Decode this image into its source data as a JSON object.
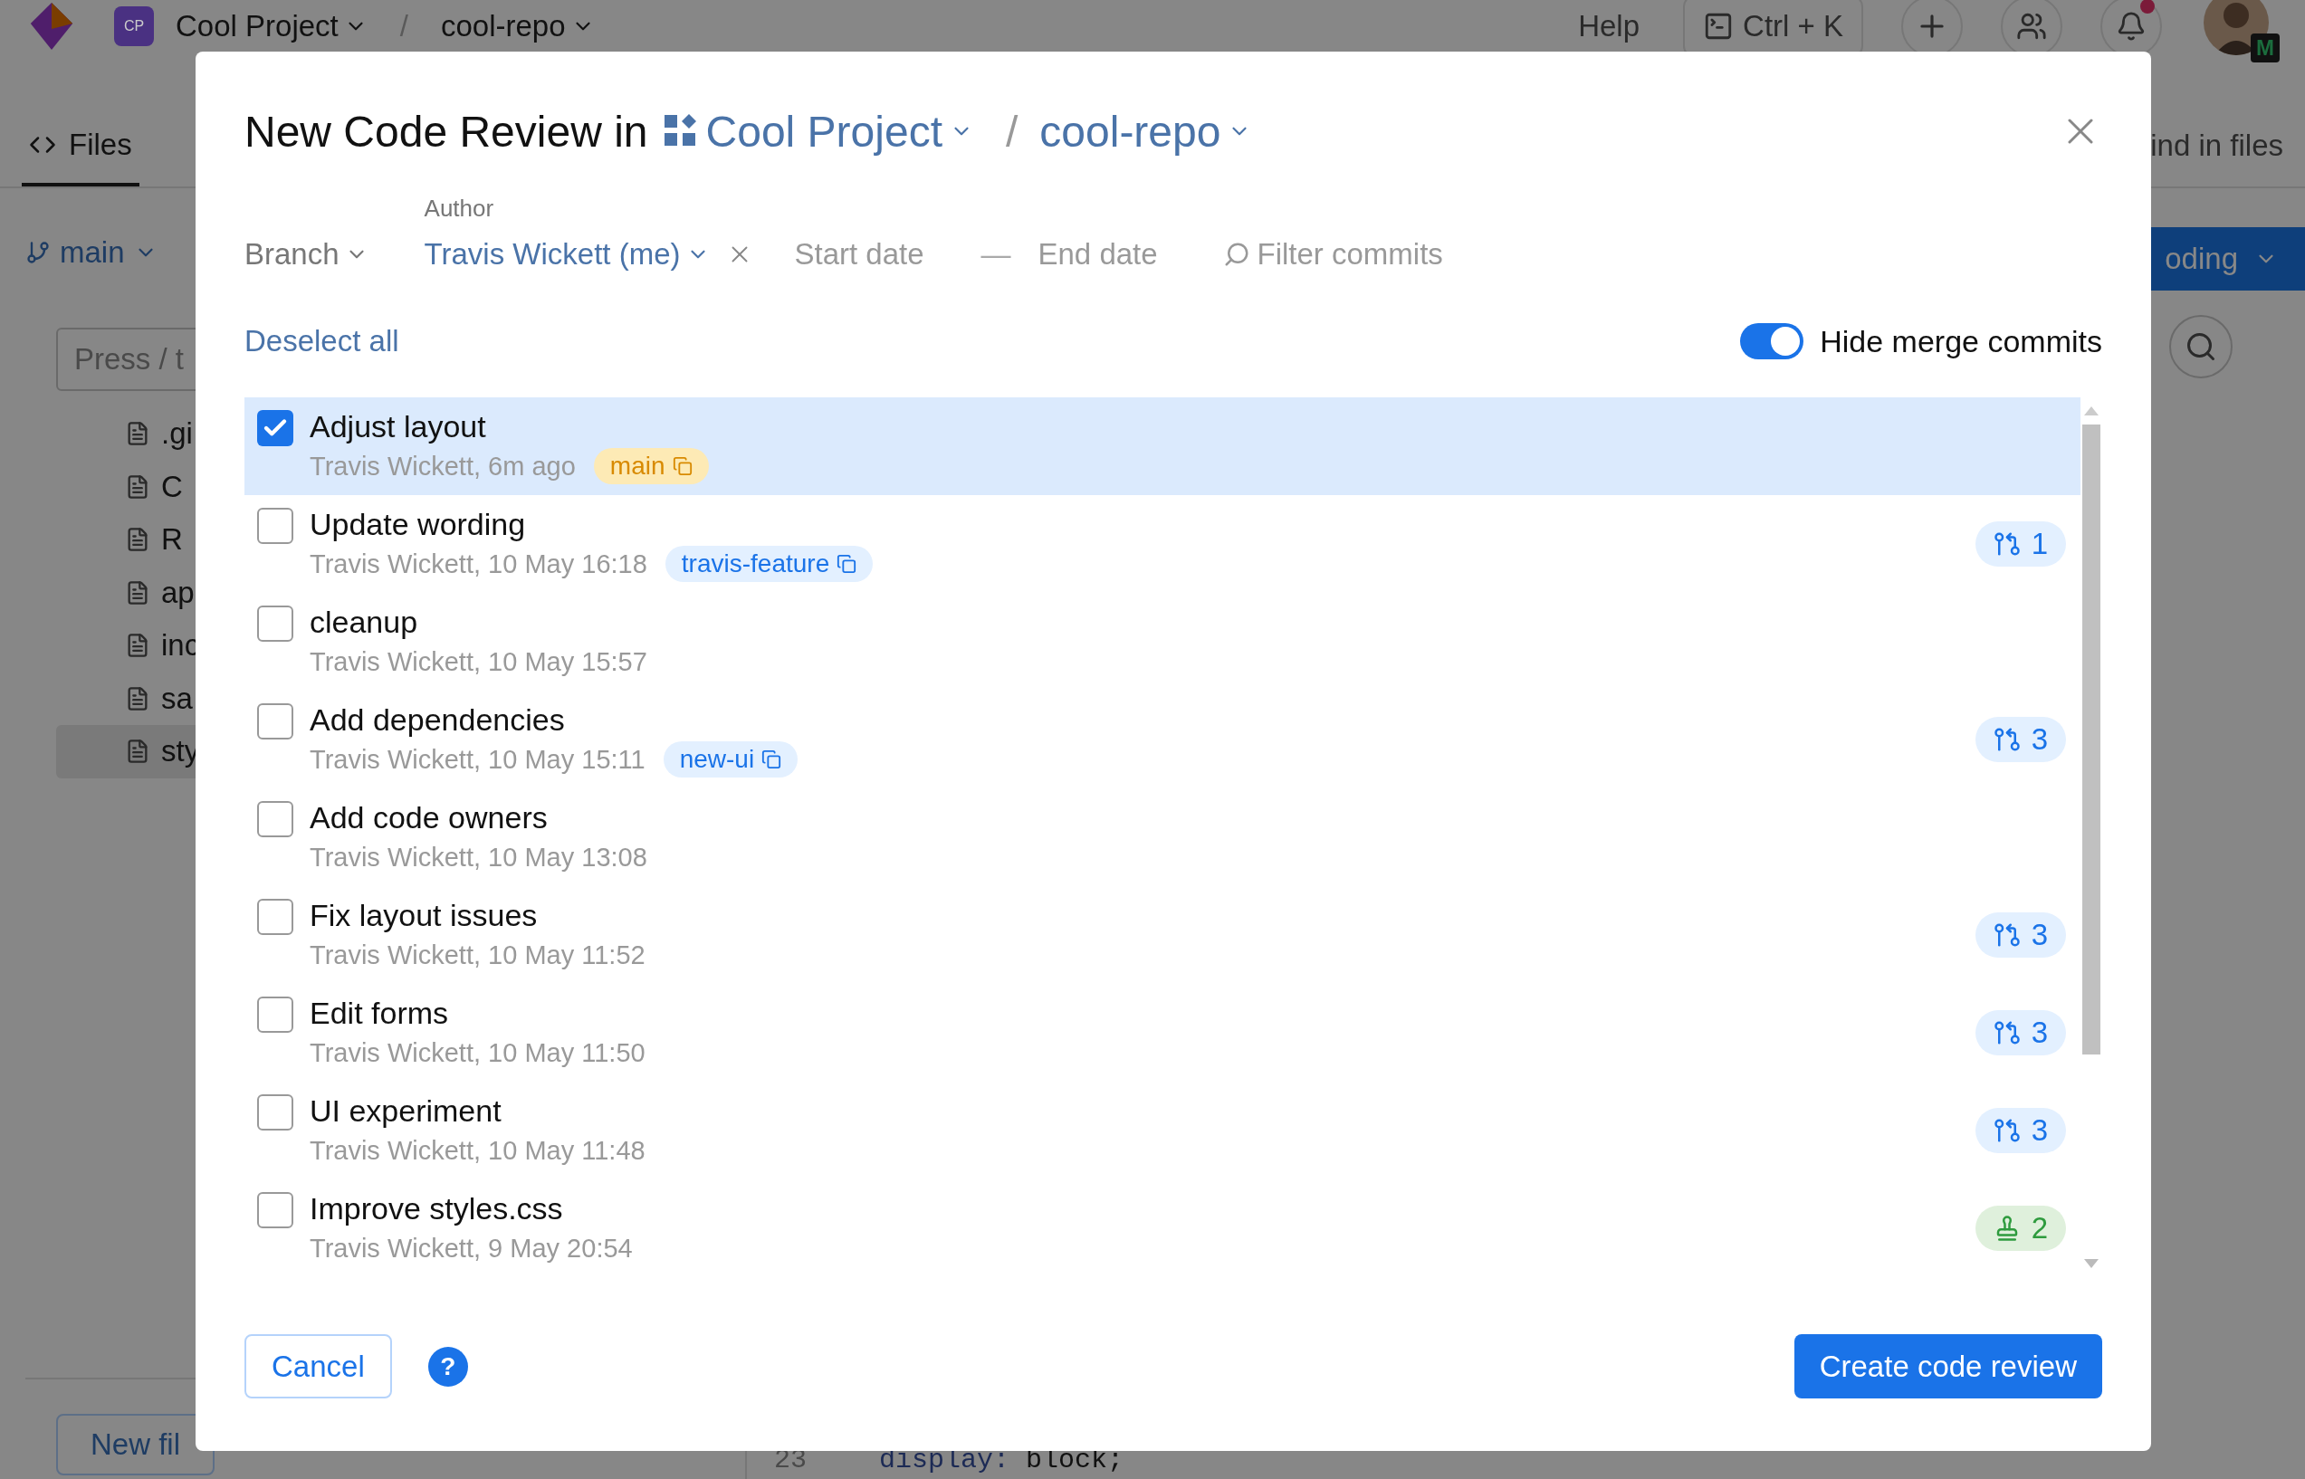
{
  "app": {
    "project": {
      "initials": "CP",
      "name": "Cool Project"
    },
    "separator": "/",
    "repo": "cool-repo",
    "help": "Help",
    "command": "Ctrl + K",
    "notifications": {
      "unread": true
    },
    "avatar_badge": "M"
  },
  "tabs": [
    {
      "label": "Files",
      "selected": true
    }
  ],
  "find": "ind in files",
  "branch": "main",
  "action_button": "oding",
  "search": {
    "placeholder": "Press / t"
  },
  "files": [
    {
      "name": ".gi",
      "selected": false
    },
    {
      "name": "C",
      "selected": false
    },
    {
      "name": "R",
      "selected": false
    },
    {
      "name": "ap",
      "selected": false
    },
    {
      "name": "inc",
      "selected": false
    },
    {
      "name": "sa",
      "selected": false
    },
    {
      "name": "sty",
      "selected": true
    }
  ],
  "file_buttons": [
    "New fil"
  ],
  "code": {
    "line_number": "23",
    "keyword": "display:",
    "value": "block;"
  },
  "dialog": {
    "title": "New Code Review in",
    "project": "Cool Project",
    "separator": "/",
    "repo": "cool-repo",
    "filters": {
      "branch": "Branch",
      "author_label": "Author",
      "author": "Travis Wickett (me)",
      "start_date": {
        "placeholder": "Start date"
      },
      "dash": "—",
      "end_date": {
        "placeholder": "End date"
      },
      "search": {
        "placeholder": "Filter commits"
      }
    },
    "deselect": "Deselect all",
    "hide_merge": {
      "label": "Hide merge commits",
      "on": true
    },
    "commits": [
      {
        "title": "Adjust layout",
        "meta": "Travis Wickett, 6m ago",
        "checked": true,
        "selected": true,
        "branch": {
          "name": "main",
          "color": "#d88a00"
        }
      },
      {
        "title": "Update wording",
        "meta": "Travis Wickett, 10 May 16:18",
        "checked": false,
        "selected": false,
        "branch": {
          "name": "travis-feature",
          "color": "#1a73e8"
        },
        "badge": {
          "kind": "reviews",
          "count": "1"
        }
      },
      {
        "title": "cleanup",
        "meta": "Travis Wickett, 10 May 15:57",
        "checked": false,
        "selected": false
      },
      {
        "title": "Add dependencies",
        "meta": "Travis Wickett, 10 May 15:11",
        "checked": false,
        "selected": false,
        "branch": {
          "name": "new-ui",
          "color": "#1a73e8"
        },
        "badge": {
          "kind": "reviews",
          "count": "3"
        }
      },
      {
        "title": "Add code owners",
        "meta": "Travis Wickett, 10 May 13:08",
        "checked": false,
        "selected": false
      },
      {
        "title": "Fix layout issues",
        "meta": "Travis Wickett, 10 May 11:52",
        "checked": false,
        "selected": false,
        "badge": {
          "kind": "reviews",
          "count": "3"
        }
      },
      {
        "title": "Edit forms",
        "meta": "Travis Wickett, 10 May 11:50",
        "checked": false,
        "selected": false,
        "badge": {
          "kind": "reviews",
          "count": "3"
        }
      },
      {
        "title": "UI experiment",
        "meta": "Travis Wickett, 10 May 11:48",
        "checked": false,
        "selected": false,
        "badge": {
          "kind": "reviews",
          "count": "3"
        }
      },
      {
        "title": "Improve styles.css",
        "meta": "Travis Wickett, 9 May 20:54",
        "checked": false,
        "selected": false,
        "badge": {
          "kind": "approvals",
          "count": "2"
        }
      }
    ],
    "cancel": "Cancel",
    "help": "?",
    "create": "Create code review"
  }
}
